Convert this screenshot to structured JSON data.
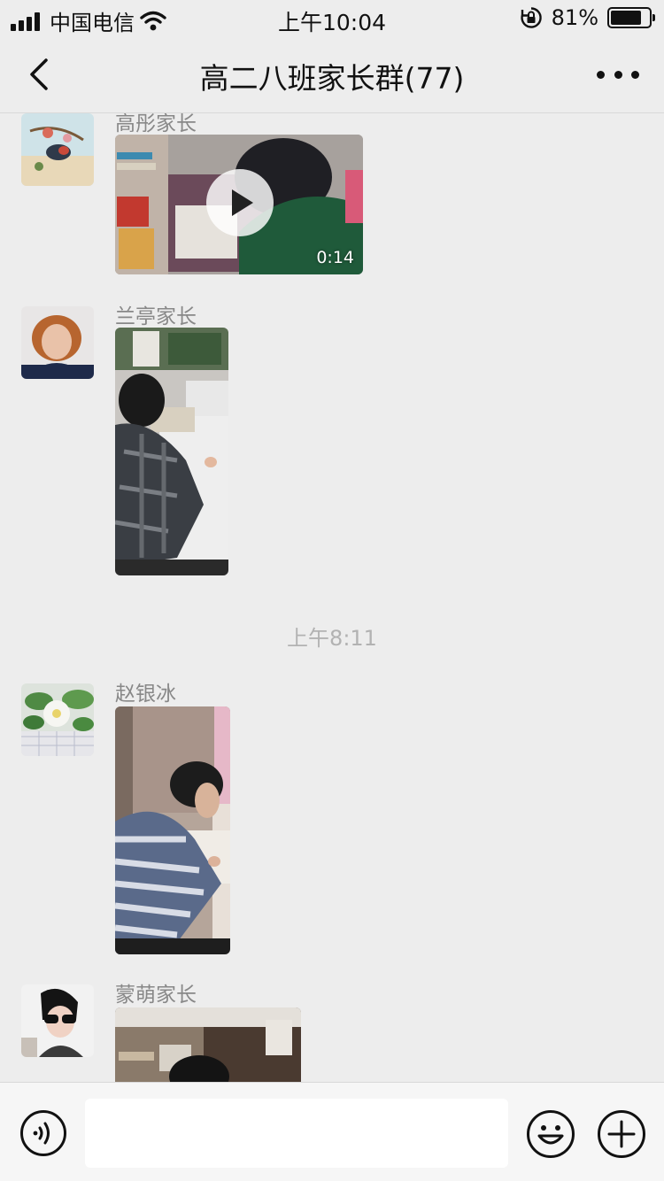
{
  "status_bar": {
    "carrier": "中国电信",
    "time": "上午10:04",
    "battery_percent": "81%",
    "battery_level": 0.81,
    "icons": [
      "signal-icon",
      "wifi-icon",
      "rotation-lock-icon",
      "battery-icon"
    ]
  },
  "nav": {
    "back_icon": "chevron-left-icon",
    "title": "高二八班家长群(77)",
    "more_icon": "more-icon"
  },
  "messages": [
    {
      "sender": "高彤家长",
      "type": "video",
      "duration": "0:14"
    },
    {
      "sender": "兰亭家长",
      "type": "image"
    },
    {
      "type": "timestamp",
      "text": "上午8:11"
    },
    {
      "sender": "赵银冰",
      "type": "image"
    },
    {
      "sender": "蒙萌家长",
      "type": "image"
    }
  ],
  "input_bar": {
    "voice_icon": "voice-icon",
    "text_value": "",
    "emoji_icon": "emoji-icon",
    "plus_icon": "plus-icon"
  },
  "colors": {
    "background": "#ededed",
    "sender_text": "#888888",
    "timestamp_text": "#b2b2b2"
  }
}
